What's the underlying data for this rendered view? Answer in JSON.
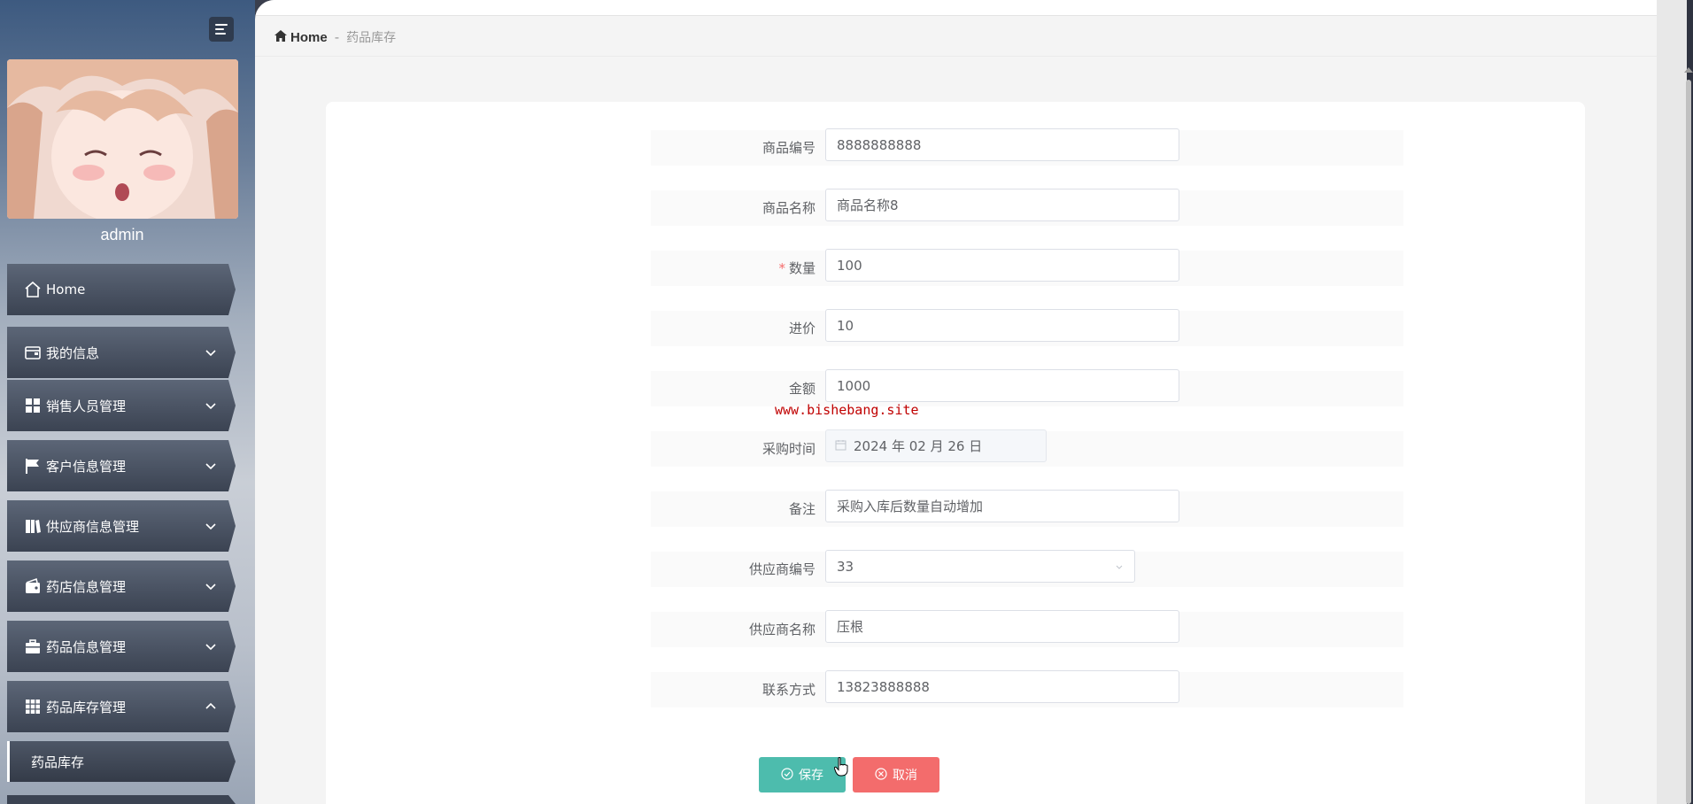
{
  "sidebar": {
    "username": "admin",
    "menu": [
      {
        "label": "Home",
        "icon": "home-icon",
        "expandable": false
      },
      {
        "label": "我的信息",
        "icon": "wallet-icon",
        "expandable": true,
        "expanded": false
      },
      {
        "label": "销售人员管理",
        "icon": "grid-icon",
        "expandable": true,
        "expanded": false
      },
      {
        "label": "客户信息管理",
        "icon": "flag-icon",
        "expandable": true,
        "expanded": false
      },
      {
        "label": "供应商信息管理",
        "icon": "book-icon",
        "expandable": true,
        "expanded": false
      },
      {
        "label": "药店信息管理",
        "icon": "wallet-icon",
        "expandable": true,
        "expanded": false
      },
      {
        "label": "药品信息管理",
        "icon": "briefcase-icon",
        "expandable": true,
        "expanded": false
      },
      {
        "label": "药品库存管理",
        "icon": "grid-icon",
        "expandable": true,
        "expanded": true
      }
    ],
    "submenu": {
      "label": "药品库存",
      "active": true
    }
  },
  "breadcrumb": {
    "home": "Home",
    "separator": "-",
    "current": "药品库存"
  },
  "form": {
    "fields": [
      {
        "label": "商品编号",
        "value": "8888888888",
        "required": false,
        "type": "text"
      },
      {
        "label": "商品名称",
        "value": "商品名称8",
        "required": false,
        "type": "text"
      },
      {
        "label": "数量",
        "value": "100",
        "required": true,
        "type": "text"
      },
      {
        "label": "进价",
        "value": "10",
        "required": false,
        "type": "text"
      },
      {
        "label": "金额",
        "value": "1000",
        "required": false,
        "type": "text"
      },
      {
        "label": "采购时间",
        "value": "2024 年 02 月 26 日",
        "required": false,
        "type": "date"
      },
      {
        "label": "备注",
        "value": "采购入库后数量自动增加",
        "required": false,
        "type": "text"
      },
      {
        "label": "供应商编号",
        "value": "33",
        "required": false,
        "type": "select"
      },
      {
        "label": "供应商名称",
        "value": "压根",
        "required": false,
        "type": "text"
      },
      {
        "label": "联系方式",
        "value": "13823888888",
        "required": false,
        "type": "text"
      }
    ],
    "watermark": "www.bishebang.site"
  },
  "buttons": {
    "save": "保存",
    "cancel": "取消"
  },
  "colors": {
    "save": "#4dbcad",
    "cancel": "#f36c6c",
    "required": "#f56c6c",
    "watermark": "#c00000"
  }
}
